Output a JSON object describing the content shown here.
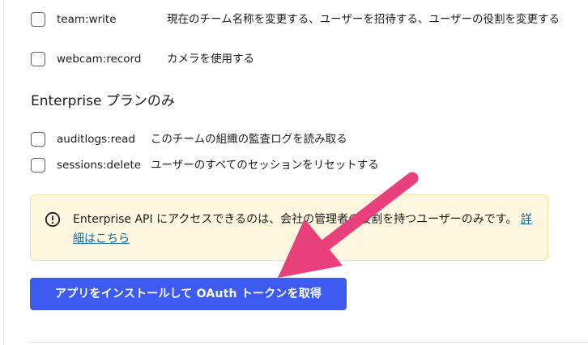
{
  "scopes_top": [
    {
      "name": "team:write",
      "description": "現在のチーム名称を変更する、ユーザーを招待する、ユーザーの役割を変更する"
    },
    {
      "name": "webcam:record",
      "description": "カメラを使用する"
    }
  ],
  "enterprise": {
    "heading": "Enterprise プランのみ",
    "scopes": [
      {
        "name": "auditlogs:read",
        "description": "このチームの組織の監査ログを読み取る"
      },
      {
        "name": "sessions:delete",
        "description": "ユーザーのすべてのセッションをリセットする"
      }
    ]
  },
  "notice": {
    "icon": "warning-circle-icon",
    "text": "Enterprise API にアクセスできるのは、会社の管理者の役割を持つユーザーのみです。",
    "link_label": "詳細はこちら"
  },
  "install_button": {
    "label": "アプリをインストールして OAuth トークンを取得"
  },
  "annotation": {
    "icon": "pointer-arrow-icon",
    "color": "#e8407a"
  },
  "colors": {
    "button": "#3d5af1",
    "notice_bg": "#fdf7df",
    "link": "#1264a3"
  }
}
